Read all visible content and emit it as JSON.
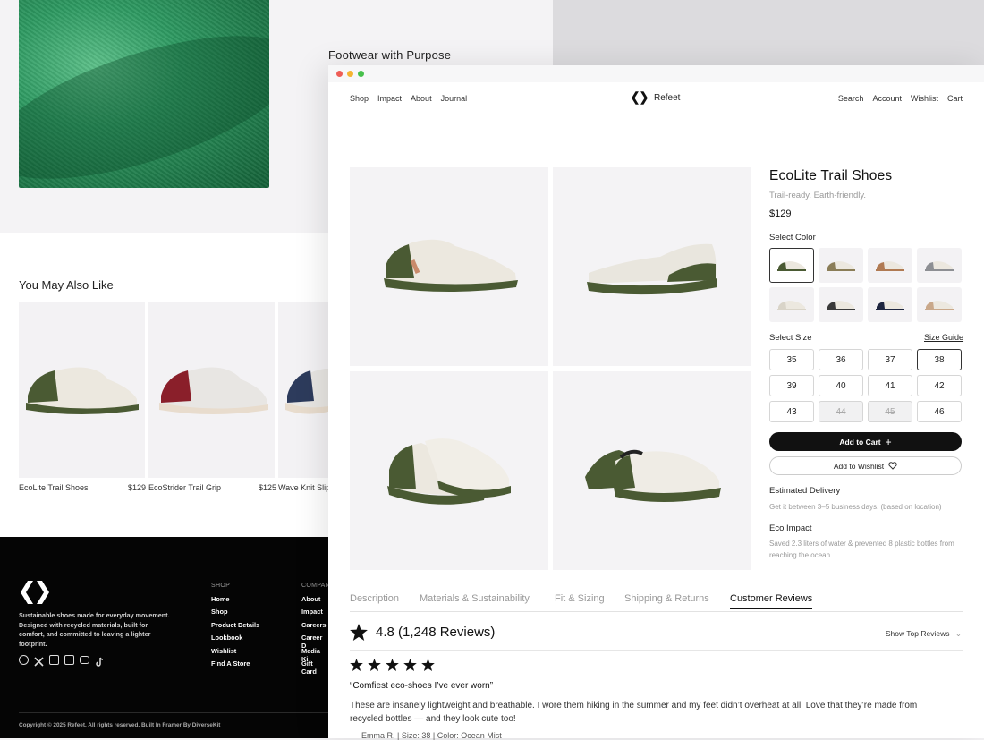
{
  "background": {
    "section_title": "Footwear with Purpose",
    "you_may_also_like": "You May Also Like",
    "recommendations": [
      {
        "name": "EcoLite Trail Shoes",
        "price": "$129",
        "accent": "#4a5a33"
      },
      {
        "name": "EcoStrider Trail Grip",
        "price": "$125",
        "accent": "#8a1f2a"
      },
      {
        "name": "Wave Knit Slip",
        "price": "",
        "accent": "#2d3b5c"
      }
    ]
  },
  "footer": {
    "description": "Sustainable shoes made for everyday movement. Designed with recycled materials, built for comfort, and committed to leaving a lighter footprint.",
    "shop_heading": "SHOP",
    "shop_links": [
      "Home",
      "Shop",
      "Product Details",
      "Lookbook",
      "Wishlist",
      "Find A Store"
    ],
    "company_heading": "COMPAN",
    "company_links": [
      "About",
      "Impact",
      "Careers",
      "Career D",
      "Media Ki",
      "Gift Card"
    ],
    "social_icons": [
      "facebook-icon",
      "x-icon",
      "instagram-icon",
      "linkedin-icon",
      "youtube-icon",
      "tiktok-icon"
    ],
    "copyright": "Copyright © 2025 Refeet. All rights reserved. Built In Framer By DiverseKit"
  },
  "nav": {
    "left": [
      "Shop",
      "Impact",
      "About",
      "Journal"
    ],
    "brand": "Refeet",
    "right": [
      "Search",
      "Account",
      "Wishlist",
      "Cart"
    ]
  },
  "product": {
    "title": "EcoLite Trail Shoes",
    "subtitle": "Trail-ready. Earth-friendly.",
    "price": "$129",
    "select_color_label": "Select Color",
    "colors": [
      {
        "name": "olive",
        "hex": "#4a5a33",
        "selected": true
      },
      {
        "name": "khaki",
        "hex": "#8a7d57",
        "selected": false
      },
      {
        "name": "tan",
        "hex": "#b07a52",
        "selected": false
      },
      {
        "name": "gray",
        "hex": "#8d8f93",
        "selected": false
      },
      {
        "name": "cream",
        "hex": "#d9d4c8",
        "selected": false
      },
      {
        "name": "white-black",
        "hex": "#3a3a3a",
        "selected": false
      },
      {
        "name": "navy",
        "hex": "#1e2640",
        "selected": false
      },
      {
        "name": "sand",
        "hex": "#c9a88a",
        "selected": false
      }
    ],
    "select_size_label": "Select Size",
    "size_guide_label": "Size Guide",
    "sizes": [
      {
        "label": "35",
        "state": "available"
      },
      {
        "label": "36",
        "state": "available"
      },
      {
        "label": "37",
        "state": "available"
      },
      {
        "label": "38",
        "state": "selected"
      },
      {
        "label": "39",
        "state": "available"
      },
      {
        "label": "40",
        "state": "available"
      },
      {
        "label": "41",
        "state": "available"
      },
      {
        "label": "42",
        "state": "available"
      },
      {
        "label": "43",
        "state": "available"
      },
      {
        "label": "44",
        "state": "disabled"
      },
      {
        "label": "45",
        "state": "disabled"
      },
      {
        "label": "46",
        "state": "available"
      }
    ],
    "add_to_cart": "Add to Cart",
    "add_to_wishlist": "Add to Wishlist",
    "delivery_heading": "Estimated Delivery",
    "delivery_text": "Get it between 3–5 business days. (based on location)",
    "eco_heading": "Eco Impact",
    "eco_text": "Saved 2.3 liters of water & prevented 8 plastic bottles from reaching the ocean."
  },
  "tabs": [
    "Description",
    "Materials & Sustainability",
    "Fit & Sizing",
    "Shipping & Returns",
    "Customer Reviews"
  ],
  "active_tab": "Customer Reviews",
  "reviews": {
    "summary": "4.8 (1,248 Reviews)",
    "sort_label": "Show Top Reviews",
    "stars": 5,
    "first": {
      "title": "“Comfiest eco-shoes I’ve ever worn”",
      "body": "These are insanely lightweight and breathable. I wore them hiking in the summer and my feet didn’t overheat at all. Love that they’re made from recycled bottles — and they look cute too!",
      "meta": "Emma R. | Size: 38 | Color: Ocean Mist"
    }
  },
  "colors": {
    "accent": "#111111",
    "olive": "#4a5a33",
    "footer_bg": "#050505"
  }
}
